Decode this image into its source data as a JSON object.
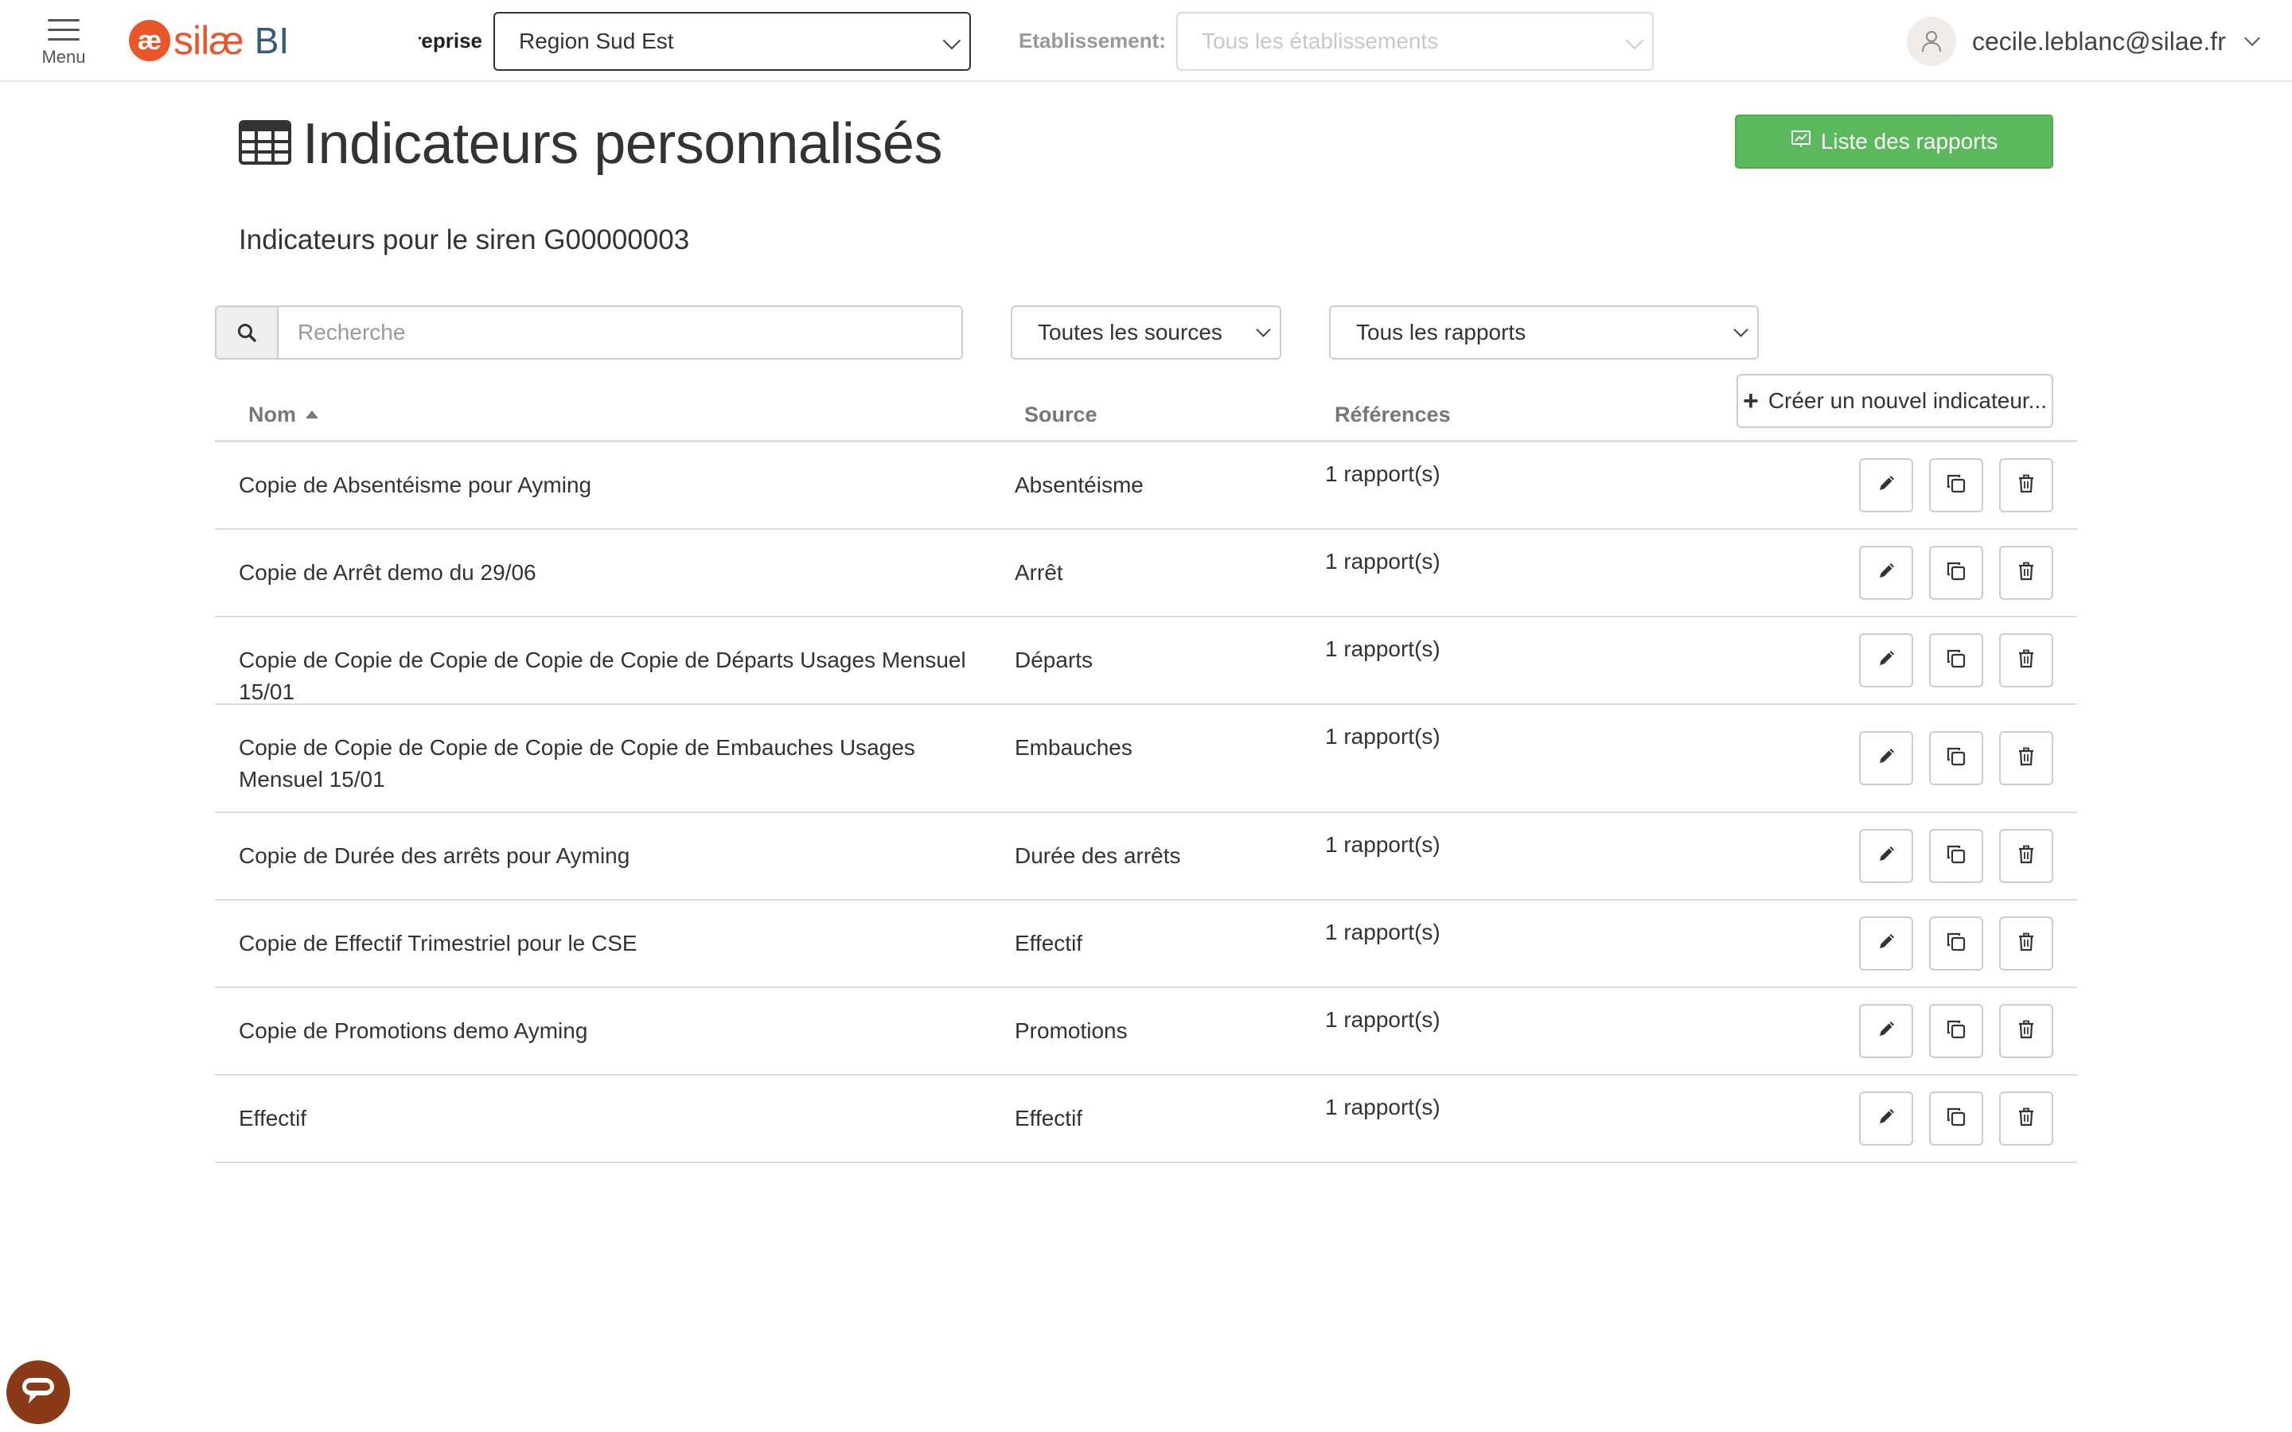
{
  "header": {
    "menu_label": "Menu",
    "logo_mark": "æ",
    "logo_text": "silæ",
    "logo_suffix": "BI",
    "entreprise_label": "Entreprise:",
    "entreprise_value": "Region Sud Est",
    "etablissement_label": "Etablissement:",
    "etablissement_placeholder": "Tous les établissements",
    "user_email": "cecile.leblanc@silae.fr"
  },
  "page": {
    "title": "Indicateurs personnalisés",
    "reports_button": "Liste des rapports",
    "subtitle": "Indicateurs pour le siren G00000003"
  },
  "filters": {
    "search_placeholder": "Recherche",
    "source_filter": "Toutes les sources",
    "report_filter": "Tous les rapports",
    "create_button": "Créer un nouvel indicateur..."
  },
  "table": {
    "columns": {
      "name": "Nom",
      "source": "Source",
      "refs": "Références"
    },
    "rows": [
      {
        "name": "Copie de Absentéisme pour Ayming",
        "source": "Absentéisme",
        "refs": "1 rapport(s)"
      },
      {
        "name": "Copie de Arrêt demo du 29/06",
        "source": "Arrêt",
        "refs": "1 rapport(s)"
      },
      {
        "name": "Copie de Copie de Copie de Copie de Copie de Départs Usages Mensuel 15/01",
        "source": "Départs",
        "refs": "1 rapport(s)"
      },
      {
        "name": "Copie de Copie de Copie de Copie de Copie de Embauches Usages Mensuel 15/01",
        "source": "Embauches",
        "refs": "1 rapport(s)"
      },
      {
        "name": "Copie de Durée des arrêts pour Ayming",
        "source": "Durée des arrêts",
        "refs": "1 rapport(s)"
      },
      {
        "name": "Copie de Effectif Trimestriel pour le CSE",
        "source": "Effectif",
        "refs": "1 rapport(s)"
      },
      {
        "name": "Copie de Promotions demo Ayming",
        "source": "Promotions",
        "refs": "1 rapport(s)"
      },
      {
        "name": "Effectif",
        "source": "Effectif",
        "refs": "1 rapport(s)"
      }
    ]
  },
  "icons": {
    "menu": "hamburger-icon",
    "title": "table-icon",
    "reports": "presentation-icon",
    "search": "search-icon",
    "user": "user-icon",
    "edit": "pencil-icon",
    "duplicate": "copy-icon",
    "delete": "trash-icon",
    "chat": "chat-icon"
  },
  "colors": {
    "brand": "#e8562a",
    "brand_secondary": "#355c7d",
    "success": "#5cb85c",
    "chat": "#8a3a16"
  }
}
